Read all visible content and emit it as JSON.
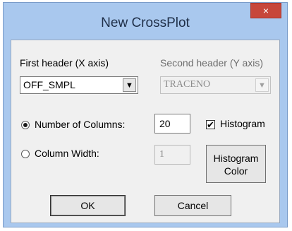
{
  "dialog": {
    "title": "New CrossPlot",
    "close_label": "×"
  },
  "first_header": {
    "label": "First header (X axis)",
    "value": "OFF_SMPL"
  },
  "second_header": {
    "label": "Second header (Y axis)",
    "value": "TRACENO"
  },
  "options": {
    "num_columns_label": "Number of Columns:",
    "num_columns_value": "20",
    "column_width_label": "Column Width:",
    "column_width_value": "1",
    "histogram_label": "Histogram",
    "histogram_check": "✔"
  },
  "buttons": {
    "histogram_color_line1": "Histogram",
    "histogram_color_line2": "Color",
    "ok": "OK",
    "cancel": "Cancel"
  },
  "icons": {
    "dropdown_arrow": "▼"
  }
}
